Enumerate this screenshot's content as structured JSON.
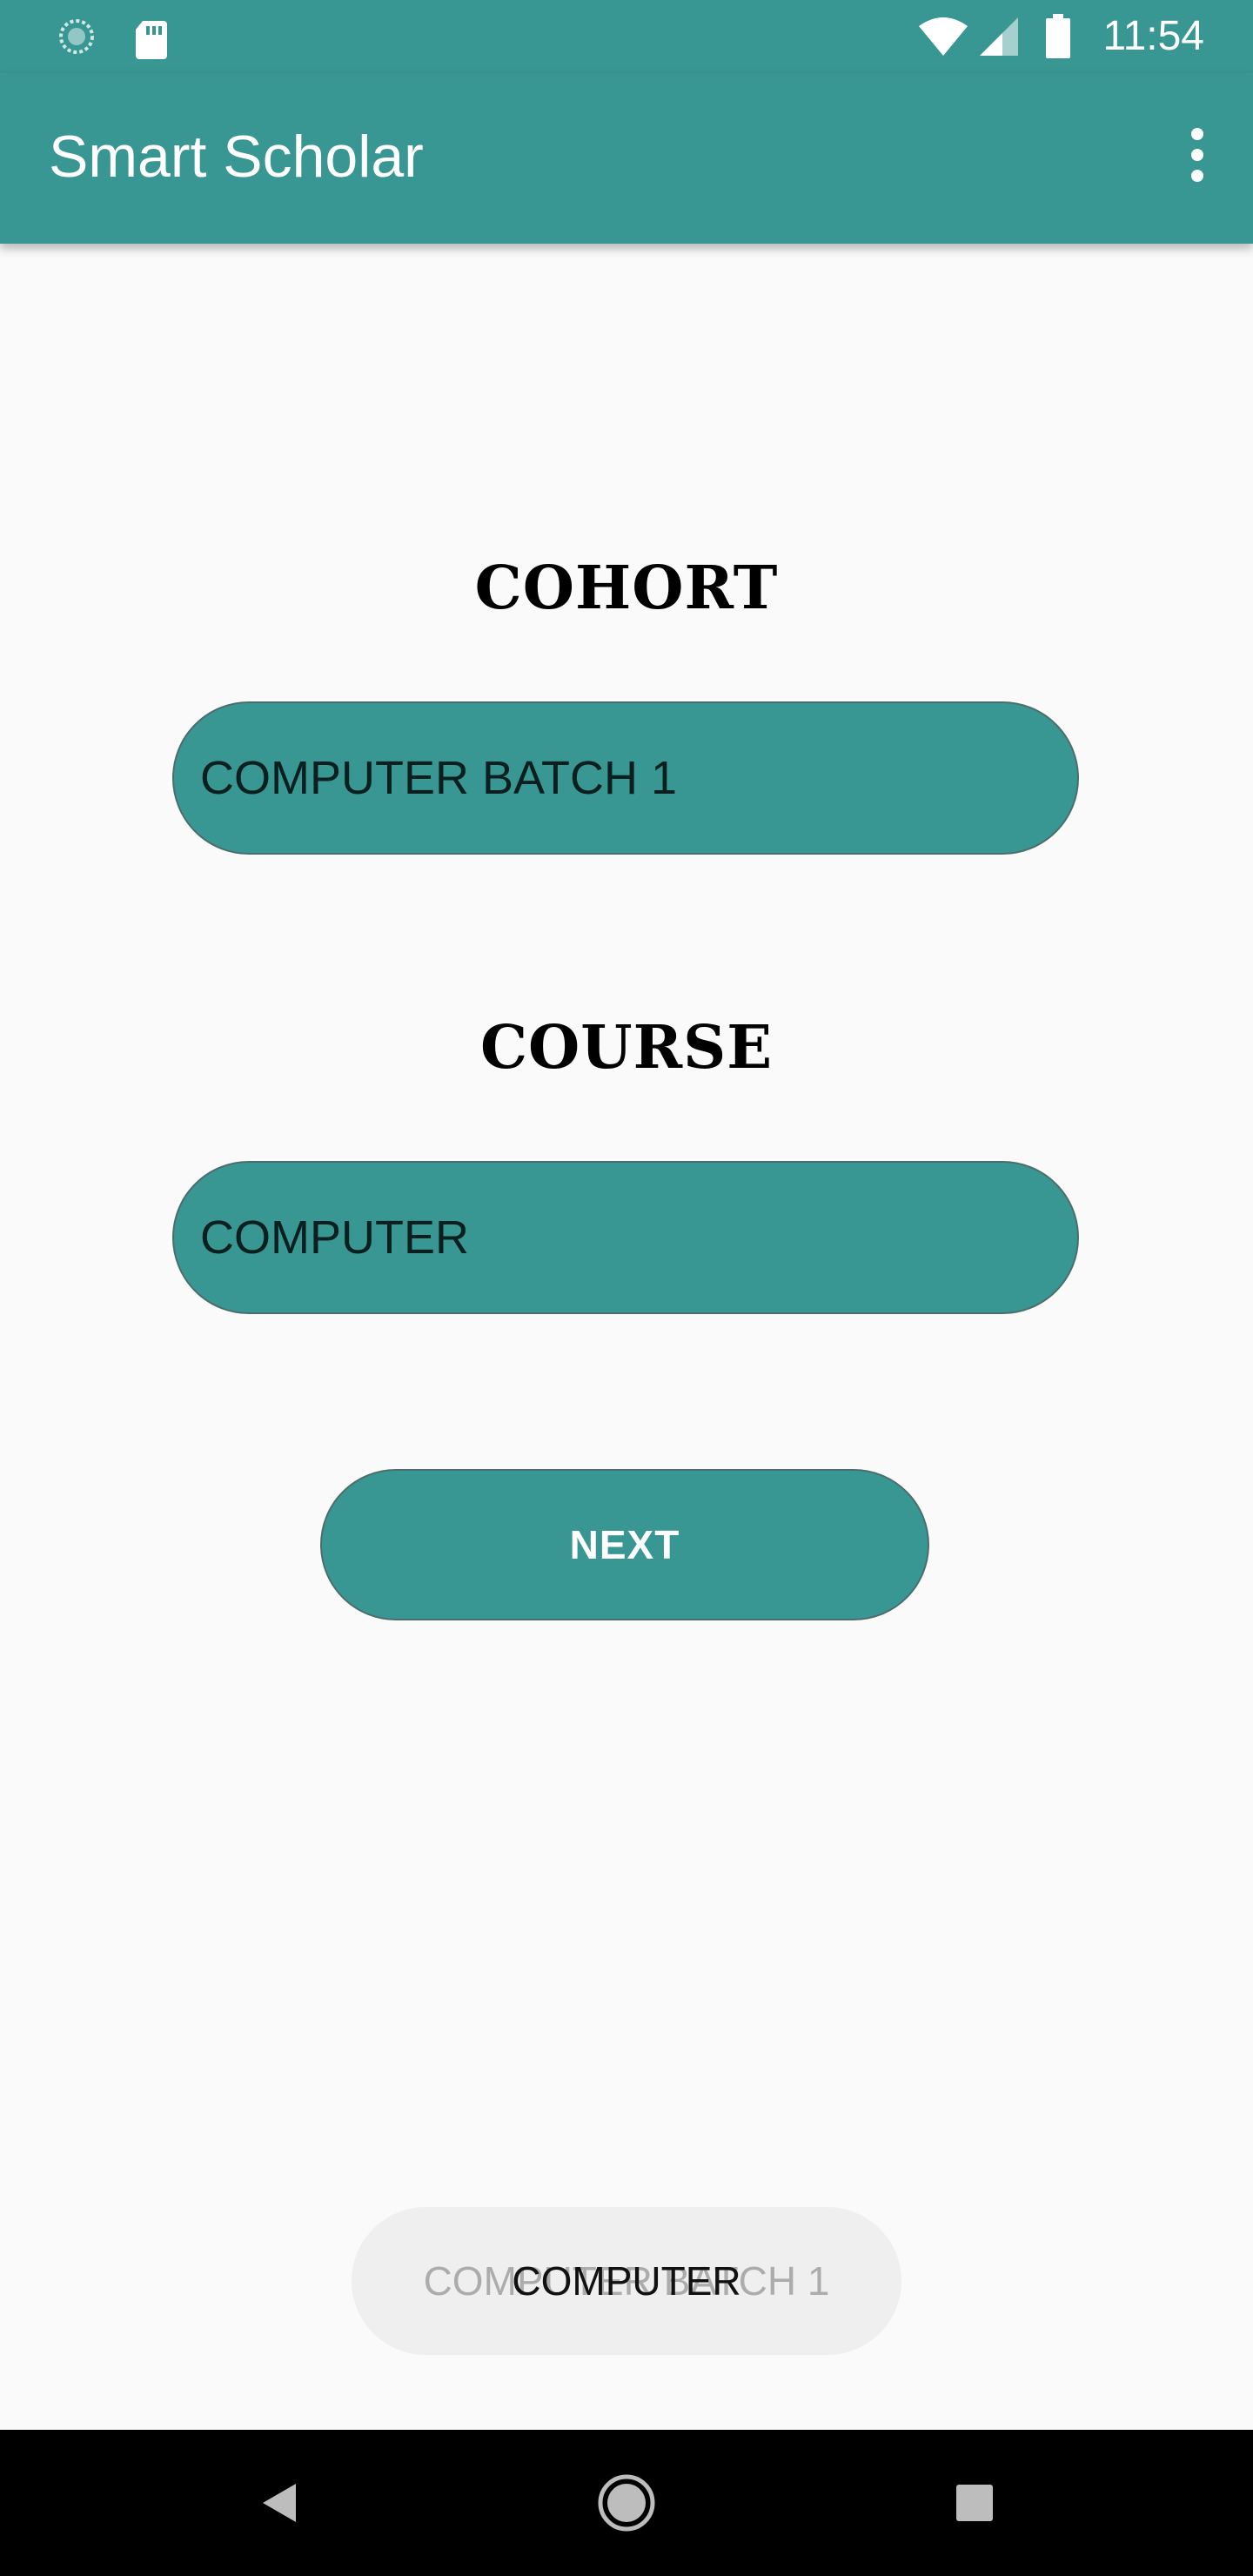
{
  "status_bar": {
    "time": "11:54",
    "icons": [
      "sync-icon",
      "sd-card-icon",
      "wifi-icon",
      "cell-signal-icon",
      "battery-icon"
    ]
  },
  "app_bar": {
    "title": "Smart Scholar",
    "menu_icon": "more-vert-icon"
  },
  "form": {
    "cohort_heading": "COHORT",
    "cohort_value": "COMPUTER BATCH 1",
    "course_heading": "COURSE",
    "course_value": "COMPUTER",
    "next_label": "NEXT"
  },
  "toasts": {
    "fading_text": "COMPUTER BATCH 1",
    "current_text": "COMPUTER"
  },
  "nav_bar": {
    "icons": [
      "back-icon",
      "home-icon",
      "recents-icon"
    ]
  },
  "colors": {
    "primary": "#399793",
    "background": "#fafafa",
    "toast": "#efefef",
    "nav_bar": "#000000"
  }
}
